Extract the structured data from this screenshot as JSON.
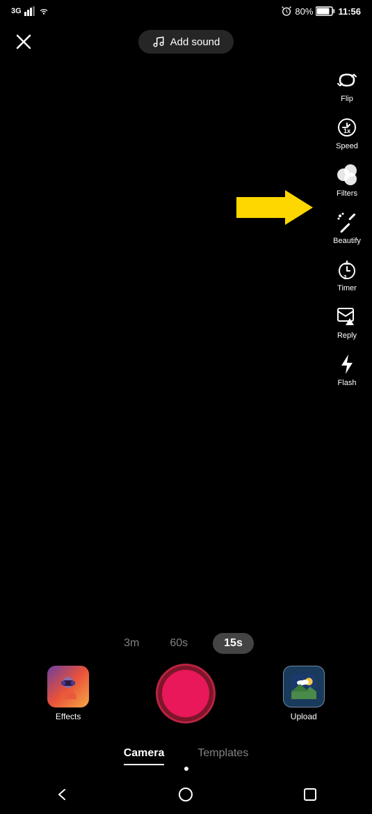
{
  "status": {
    "network": "3G",
    "signal_bars": 4,
    "wifi": true,
    "battery_percent": "80%",
    "battery_icon": "battery",
    "time": "11:56"
  },
  "header": {
    "close_label": "×",
    "add_sound_label": "Add sound"
  },
  "tools": [
    {
      "id": "flip",
      "label": "Flip",
      "icon": "flip"
    },
    {
      "id": "speed",
      "label": "Speed",
      "icon": "speed"
    },
    {
      "id": "filters",
      "label": "Filters",
      "icon": "filters"
    },
    {
      "id": "beautify",
      "label": "Beautify",
      "icon": "beautify"
    },
    {
      "id": "timer",
      "label": "Timer",
      "icon": "timer"
    },
    {
      "id": "reply",
      "label": "Reply",
      "icon": "reply"
    },
    {
      "id": "flash",
      "label": "Flash",
      "icon": "flash"
    }
  ],
  "durations": [
    {
      "label": "3m",
      "active": false
    },
    {
      "label": "60s",
      "active": false
    },
    {
      "label": "15s",
      "active": true
    }
  ],
  "bottom": {
    "effects_label": "Effects",
    "upload_label": "Upload"
  },
  "tabs": [
    {
      "label": "Camera",
      "active": true
    },
    {
      "label": "Templates",
      "active": false
    }
  ],
  "nav": {
    "back_icon": "◁",
    "home_icon": "○",
    "square_icon": "□"
  }
}
